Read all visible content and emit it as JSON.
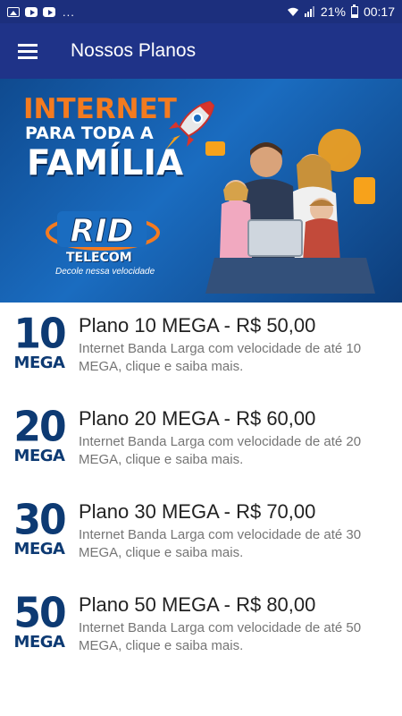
{
  "status_bar": {
    "signal_text": "21%",
    "time": "00:17",
    "notification_dots": "..."
  },
  "app_bar": {
    "title": "Nossos Planos",
    "menu_icon": "hamburger-menu-icon"
  },
  "banner": {
    "headline_line1": "INTERNET",
    "headline_line2": "PARA TODA A",
    "headline_line3": "FAMÍLIA",
    "logo_text": "RID",
    "logo_subtitle": "TELECOM",
    "slogan": "Decole nessa velocidade",
    "colors": {
      "orange": "#f47b20",
      "blue": "#1a6cc0"
    }
  },
  "plans": [
    {
      "badge_number": "10",
      "badge_unit": "MEGA",
      "title": "Plano 10 MEGA - R$ 50,00",
      "description": "Internet Banda Larga com velocidade de até 10 MEGA, clique e saiba mais."
    },
    {
      "badge_number": "20",
      "badge_unit": "MEGA",
      "title": "Plano 20 MEGA - R$ 60,00",
      "description": "Internet Banda Larga com velocidade de até 20 MEGA, clique e saiba mais."
    },
    {
      "badge_number": "30",
      "badge_unit": "MEGA",
      "title": "Plano 30 MEGA - R$ 70,00",
      "description": "Internet Banda Larga com velocidade de até 30 MEGA, clique e saiba mais."
    },
    {
      "badge_number": "50",
      "badge_unit": "MEGA",
      "title": "Plano 50 MEGA - R$ 80,00",
      "description": "Internet Banda Larga com velocidade de até 50 MEGA, clique e saiba mais."
    }
  ],
  "colors": {
    "app_bar": "#1f3388",
    "status_bar": "#1c2f7d",
    "badge": "#0d3a73"
  }
}
